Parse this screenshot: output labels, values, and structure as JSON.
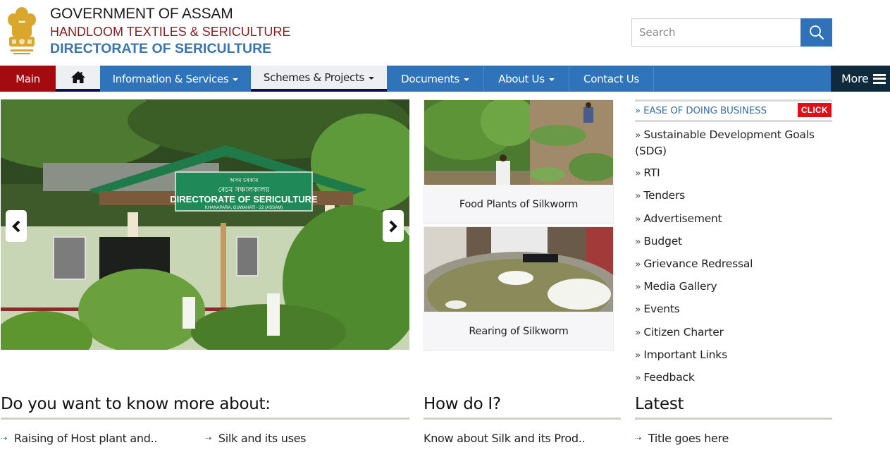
{
  "header": {
    "emblem_icon": "state-emblem-icon",
    "title_line1": "GOVERNMENT OF ASSAM",
    "title_line2": "HANDLOOM TEXTILES & SERICULTURE",
    "title_line3": "DIRECTORATE OF SERICULTURE",
    "search": {
      "placeholder": "Search",
      "value": "",
      "button_icon": "search-icon"
    }
  },
  "colors": {
    "nav_blue": "#2f73ba",
    "main_red": "#a30b10",
    "more_dark": "#0f2a3d",
    "title_red": "#8a1c22",
    "title_blue": "#3a74b6",
    "click_red": "#e10d17"
  },
  "nav": {
    "main": "Main",
    "home_icon": "home-icon",
    "items": [
      {
        "label": "Information & Services",
        "dropdown": true
      },
      {
        "label": "Schemes & Projects",
        "dropdown": true
      },
      {
        "label": "Documents",
        "dropdown": true
      },
      {
        "label": "About Us",
        "dropdown": true
      },
      {
        "label": "Contact Us",
        "dropdown": false
      }
    ],
    "more": "More"
  },
  "slider": {
    "image_alt": "Directorate of Sericulture office building",
    "sign_text": "DIRECTORATE OF SERICULTURE",
    "sign_subtext": "KHANAPARA, GUWAHATI - 22 (ASSAM)",
    "sign_top": "অসম চৰকাৰ",
    "sign_assamese": "ৰেচম সঞ্চালকালয়",
    "prev_icon": "chevron-left-icon",
    "next_icon": "chevron-right-icon"
  },
  "cards": [
    {
      "caption": "Food Plants of Silkworm"
    },
    {
      "caption": "Rearing of Silkworm"
    }
  ],
  "sidebar": {
    "ease_label": "EASE OF DOING BUSINESS",
    "click_badge": "CLICK",
    "links": [
      "Sustainable Development Goals (SDG)",
      "RTI",
      "Tenders",
      "Advertisement",
      "Budget",
      "Grievance Redressal",
      "Media Gallery",
      "Events",
      "Citizen Charter",
      "Important Links",
      "Feedback"
    ]
  },
  "sections": {
    "know_more": {
      "title": "Do you want to know more about:",
      "links": [
        "Raising of Host plant and..",
        "Silk and its uses"
      ]
    },
    "how_do_i": {
      "title": "How do I?",
      "links": [
        "Know about Silk and its Prod.."
      ]
    },
    "latest": {
      "title": "Latest",
      "links": [
        "Title goes here"
      ]
    }
  }
}
